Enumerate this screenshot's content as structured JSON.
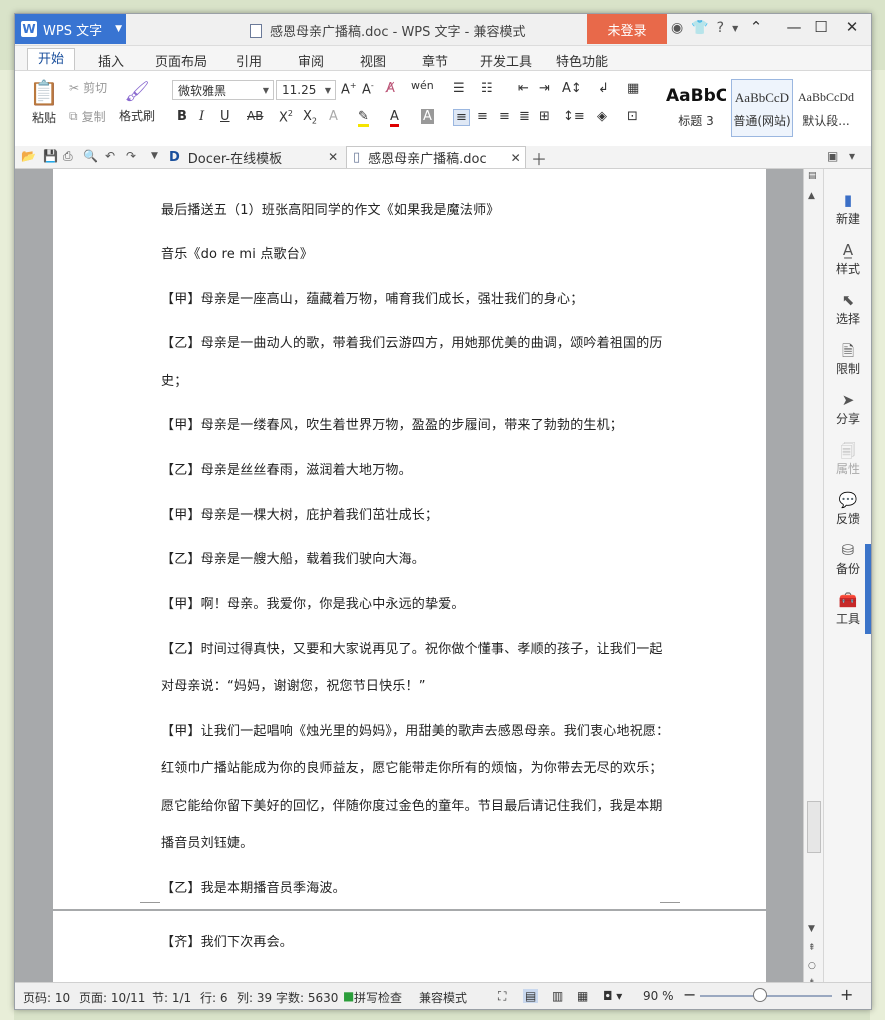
{
  "titlebar": {
    "app_name": "WPS 文字",
    "doc_title": "感恩母亲广播稿.doc - WPS 文字 - 兼容模式",
    "login": "未登录",
    "help": "?"
  },
  "ribbon_tabs": [
    "开始",
    "插入",
    "页面布局",
    "引用",
    "审阅",
    "视图",
    "章节",
    "开发工具",
    "特色功能"
  ],
  "ribbon": {
    "paste": "粘贴",
    "cut": "剪切",
    "copy": "复制",
    "format_painter": "格式刷",
    "font_name": "微软雅黑",
    "font_size": "11.25",
    "styles": [
      {
        "preview": "AaBbC",
        "name": "标题 3"
      },
      {
        "preview": "AaBbCcD",
        "name": "普通(网站)"
      },
      {
        "preview": "AaBbCcDd",
        "name": "默认段..."
      }
    ]
  },
  "doc_tabs": [
    {
      "label": "Docer-在线模板"
    },
    {
      "label": "感恩母亲广播稿.doc"
    }
  ],
  "document": {
    "lines": [
      "最后播送五（1）班张高阳同学的作文《如果我是魔法师》",
      "音乐《do re mi 点歌台》",
      "【甲】母亲是一座高山，蕴藏着万物，哺育我们成长，强壮我们的身心；",
      "【乙】母亲是一曲动人的歌，带着我们云游四方，用她那优美的曲调，颂吟着祖国的历",
      "史；",
      "【甲】母亲是一缕春风，吹生着世界万物，盈盈的步履间，带来了勃勃的生机；",
      "【乙】母亲是丝丝春雨，滋润着大地万物。",
      "【甲】母亲是一棵大树，庇护着我们茁壮成长；",
      "【乙】母亲是一艘大船，载着我们驶向大海。",
      "【甲】啊！母亲。我爱你，你是我心中永远的挚爱。",
      "【乙】时间过得真快，又要和大家说再见了。祝你做个懂事、孝顺的孩子，让我们一起",
      "对母亲说：“妈妈，谢谢您，祝您节日快乐！”",
      "【甲】让我们一起唱响《烛光里的妈妈》，用甜美的歌声去感恩母亲。我们衷心地祝愿：",
      "红领巾广播站能成为你的良师益友，愿它能带走你所有的烦恼，为你带去无尽的欢乐；",
      "愿它能给你留下美好的回忆，伴随你度过金色的童年。节目最后请记住我们，我是本期",
      "播音员刘钰婕。",
      "【乙】我是本期播音员季海波。"
    ],
    "page2_lines": [
      "【齐】我们下次再会。"
    ]
  },
  "task_pane": [
    "新建",
    "样式",
    "选择",
    "限制",
    "分享",
    "属性",
    "反馈",
    "备份",
    "工具"
  ],
  "status": {
    "page_num": "页码: 10",
    "pages": "页面: 10/11",
    "section": "节: 1/1",
    "row": "行: 6",
    "col": "列: 39",
    "word_count": "字数: 5630",
    "spell": "拼写检查",
    "compat": "兼容模式",
    "zoom": "90 %",
    "zoom_level_percent": 90
  },
  "colors": {
    "accent": "#3874d2",
    "login": "#e8694a"
  }
}
